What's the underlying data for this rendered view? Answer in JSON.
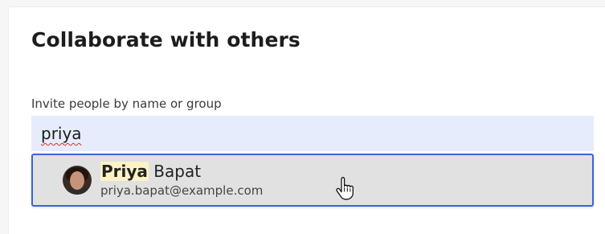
{
  "dialog": {
    "title": "Collaborate with others",
    "invite_label": "Invite people by name or group",
    "search_value": "priya"
  },
  "suggestions": [
    {
      "name_match": "Priya",
      "name_rest": " Bapat",
      "email": "priya.bapat@example.com",
      "avatar": "person-photo"
    }
  ],
  "colors": {
    "search_background": "#e7ecfc",
    "dropdown_border": "#3b64d8",
    "match_highlight": "#fbf3c4"
  },
  "icons": {
    "cursor": "hand-pointer-icon"
  }
}
